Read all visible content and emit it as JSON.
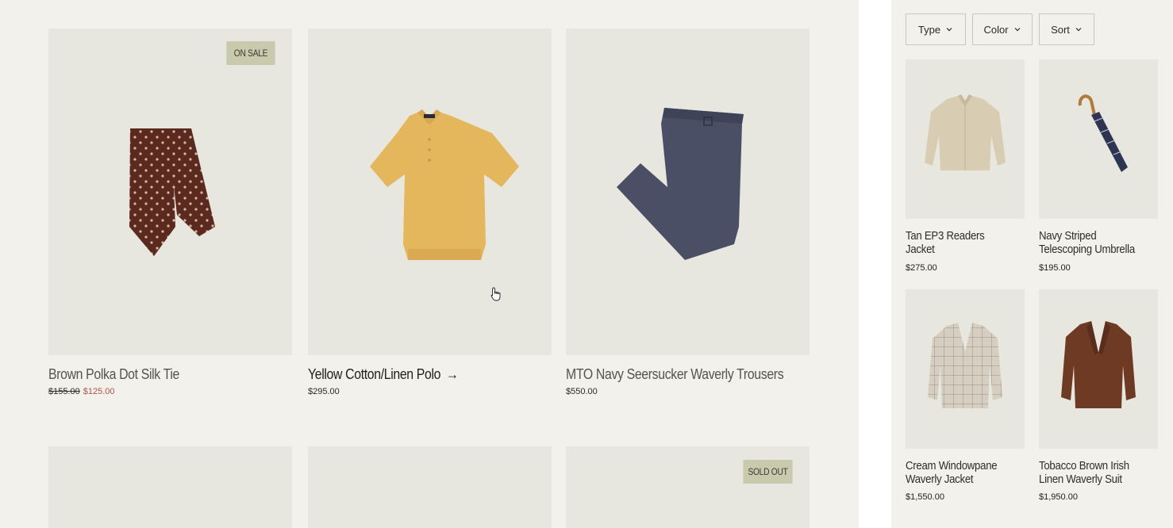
{
  "filters": [
    {
      "label": "Type"
    },
    {
      "label": "Color"
    },
    {
      "label": "Sort"
    }
  ],
  "main_products": [
    {
      "name": "Brown Polka Dot Silk Tie",
      "price_original": "$155.00",
      "price_sale": "$125.00",
      "badge": "ON SALE",
      "image": "tie-icon"
    },
    {
      "name": "Yellow Cotton/Linen Polo",
      "price": "$295.00",
      "image": "polo-icon",
      "arrow": "→"
    },
    {
      "name": "MTO Navy Seersucker Waverly Trousers",
      "price": "$550.00",
      "image": "trousers-icon"
    },
    {
      "name": "",
      "price": "",
      "image": ""
    },
    {
      "name": "",
      "price": "",
      "image": ""
    },
    {
      "name": "",
      "price": "",
      "badge": "SOLD OUT",
      "image": ""
    }
  ],
  "side_products": [
    {
      "name": "Tan EP3 Readers Jacket",
      "price": "$275.00",
      "image": "jacket-icon"
    },
    {
      "name": "Navy Striped Telescoping Umbrella",
      "price": "$195.00",
      "image": "umbrella-icon"
    },
    {
      "name": "Cream Windowpane Waverly Jacket",
      "price": "$1,550.00",
      "image": "blazer-icon"
    },
    {
      "name": "Tobacco Brown Irish Linen Waverly Suit",
      "price": "$1,950.00",
      "image": "suit-icon"
    }
  ],
  "colors": {
    "background": "#f2f1ec",
    "image_bg": "#e7e6df",
    "badge": "#c9c9ae",
    "sale": "#b3534b"
  }
}
